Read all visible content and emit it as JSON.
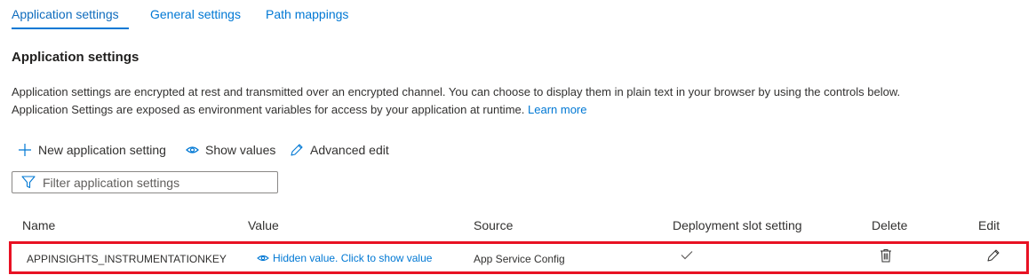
{
  "tabs": [
    {
      "label": "Application settings",
      "active": true
    },
    {
      "label": "General settings",
      "active": false
    },
    {
      "label": "Path mappings",
      "active": false
    }
  ],
  "section": {
    "title": "Application settings",
    "description_line1": "Application settings are encrypted at rest and transmitted over an encrypted channel. You can choose to display them in plain text in your browser by using the controls below.",
    "description_line2": "Application Settings are exposed as environment variables for access by your application at runtime.",
    "learn_more": "Learn more"
  },
  "toolbar": {
    "new_label": "New application setting",
    "show_values_label": "Show values",
    "advanced_edit_label": "Advanced edit"
  },
  "filter": {
    "placeholder": "Filter application settings",
    "value": ""
  },
  "table": {
    "headers": {
      "name": "Name",
      "value": "Value",
      "source": "Source",
      "slot": "Deployment slot setting",
      "delete": "Delete",
      "edit": "Edit"
    },
    "rows": [
      {
        "name": "APPINSIGHTS_INSTRUMENTATIONKEY",
        "value": "Hidden value. Click to show value",
        "source": "App Service Config",
        "slot_setting": true
      }
    ]
  },
  "colors": {
    "accent": "#0078d4",
    "highlight_border": "#e81123",
    "text": "#323130"
  },
  "icons": [
    "plus-icon",
    "eye-icon",
    "pencil-icon",
    "filter-icon",
    "checkmark-icon",
    "trash-icon"
  ]
}
